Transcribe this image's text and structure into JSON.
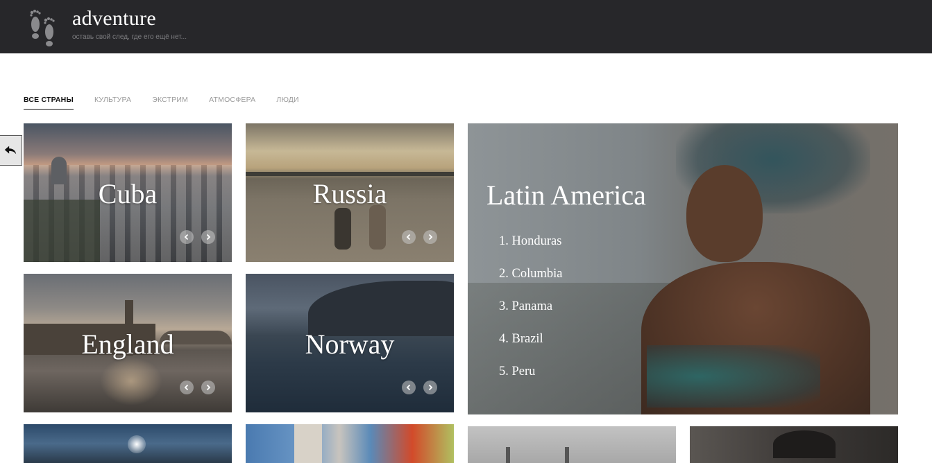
{
  "header": {
    "brand": "adventure",
    "tagline": "оставь свой след, где его ещё нет..."
  },
  "filters": [
    {
      "label": "ВСЕ СТРАНЫ",
      "active": true
    },
    {
      "label": "КУЛЬТУРА",
      "active": false
    },
    {
      "label": "ЭКСТРИМ",
      "active": false
    },
    {
      "label": "АТМОСФЕРА",
      "active": false
    },
    {
      "label": "ЛЮДИ",
      "active": false
    }
  ],
  "cards": {
    "cuba": {
      "title": "Cuba"
    },
    "russia": {
      "title": "Russia"
    },
    "england": {
      "title": "England"
    },
    "norway": {
      "title": "Norway"
    }
  },
  "featured": {
    "title": "Latin America",
    "items": [
      "1. Honduras",
      "2. Columbia",
      "3. Panama",
      "4. Brazil",
      "5. Peru"
    ]
  },
  "icons": {
    "logo": "footprints-icon",
    "back": "back-arrow-icon",
    "prev": "chevron-left-icon",
    "next": "chevron-right-icon"
  }
}
